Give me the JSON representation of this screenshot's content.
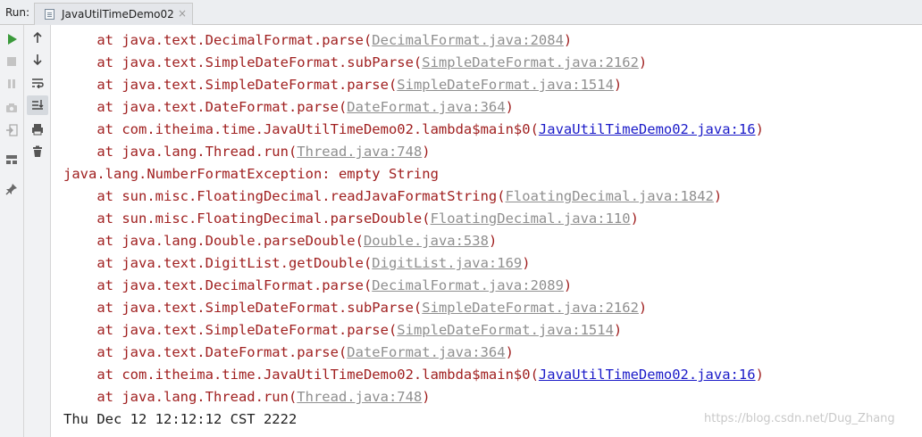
{
  "header": {
    "run_label": "Run:",
    "tab_label": "JavaUtilTimeDemo02",
    "tab_close": "×"
  },
  "console_lines": [
    {
      "prefix": "    at java.text.DecimalFormat.parse(",
      "link": "DecimalFormat.java:2084",
      "suffix": ")",
      "link_style": "grey",
      "kind": "err"
    },
    {
      "prefix": "    at java.text.SimpleDateFormat.subParse(",
      "link": "SimpleDateFormat.java:2162",
      "suffix": ")",
      "link_style": "grey",
      "kind": "err"
    },
    {
      "prefix": "    at java.text.SimpleDateFormat.parse(",
      "link": "SimpleDateFormat.java:1514",
      "suffix": ")",
      "link_style": "grey",
      "kind": "err"
    },
    {
      "prefix": "    at java.text.DateFormat.parse(",
      "link": "DateFormat.java:364",
      "suffix": ")",
      "link_style": "grey",
      "kind": "err"
    },
    {
      "prefix": "    at com.itheima.time.JavaUtilTimeDemo02.lambda$main$0(",
      "link": "JavaUtilTimeDemo02.java:16",
      "suffix": ")",
      "link_style": "blue",
      "kind": "err"
    },
    {
      "prefix": "    at java.lang.Thread.run(",
      "link": "Thread.java:748",
      "suffix": ")",
      "link_style": "grey",
      "kind": "err"
    },
    {
      "prefix": "java.lang.NumberFormatException: empty String",
      "link": "",
      "suffix": "",
      "link_style": "none",
      "kind": "err"
    },
    {
      "prefix": "    at sun.misc.FloatingDecimal.readJavaFormatString(",
      "link": "FloatingDecimal.java:1842",
      "suffix": ")",
      "link_style": "grey",
      "kind": "err"
    },
    {
      "prefix": "    at sun.misc.FloatingDecimal.parseDouble(",
      "link": "FloatingDecimal.java:110",
      "suffix": ")",
      "link_style": "grey",
      "kind": "err"
    },
    {
      "prefix": "    at java.lang.Double.parseDouble(",
      "link": "Double.java:538",
      "suffix": ")",
      "link_style": "grey",
      "kind": "err"
    },
    {
      "prefix": "    at java.text.DigitList.getDouble(",
      "link": "DigitList.java:169",
      "suffix": ")",
      "link_style": "grey",
      "kind": "err"
    },
    {
      "prefix": "    at java.text.DecimalFormat.parse(",
      "link": "DecimalFormat.java:2089",
      "suffix": ")",
      "link_style": "grey",
      "kind": "err"
    },
    {
      "prefix": "    at java.text.SimpleDateFormat.subParse(",
      "link": "SimpleDateFormat.java:2162",
      "suffix": ")",
      "link_style": "grey",
      "kind": "err"
    },
    {
      "prefix": "    at java.text.SimpleDateFormat.parse(",
      "link": "SimpleDateFormat.java:1514",
      "suffix": ")",
      "link_style": "grey",
      "kind": "err"
    },
    {
      "prefix": "    at java.text.DateFormat.parse(",
      "link": "DateFormat.java:364",
      "suffix": ")",
      "link_style": "grey",
      "kind": "err"
    },
    {
      "prefix": "    at com.itheima.time.JavaUtilTimeDemo02.lambda$main$0(",
      "link": "JavaUtilTimeDemo02.java:16",
      "suffix": ")",
      "link_style": "blue",
      "kind": "err"
    },
    {
      "prefix": "    at java.lang.Thread.run(",
      "link": "Thread.java:748",
      "suffix": ")",
      "link_style": "grey",
      "kind": "err"
    },
    {
      "prefix": "Thu Dec 12 12:12:12 CST 2222",
      "link": "",
      "suffix": "",
      "link_style": "none",
      "kind": "out"
    }
  ],
  "watermark": "https://blog.csdn.net/Dug_Zhang",
  "toolbar_left": [
    "rerun-icon",
    "stop-icon",
    "pause-icon",
    "dump-threads-icon",
    "exit-icon",
    "layout-icon",
    "pin-icon"
  ],
  "toolbar_right": [
    "up-arrow-icon",
    "down-arrow-icon",
    "soft-wrap-icon",
    "scroll-to-end-icon",
    "print-icon",
    "trash-icon"
  ],
  "colors": {
    "error_text": "#a02020",
    "link_grey": "#8f8f8f",
    "link_blue": "#1a1ac8",
    "run_green": "#3b9a3b"
  }
}
